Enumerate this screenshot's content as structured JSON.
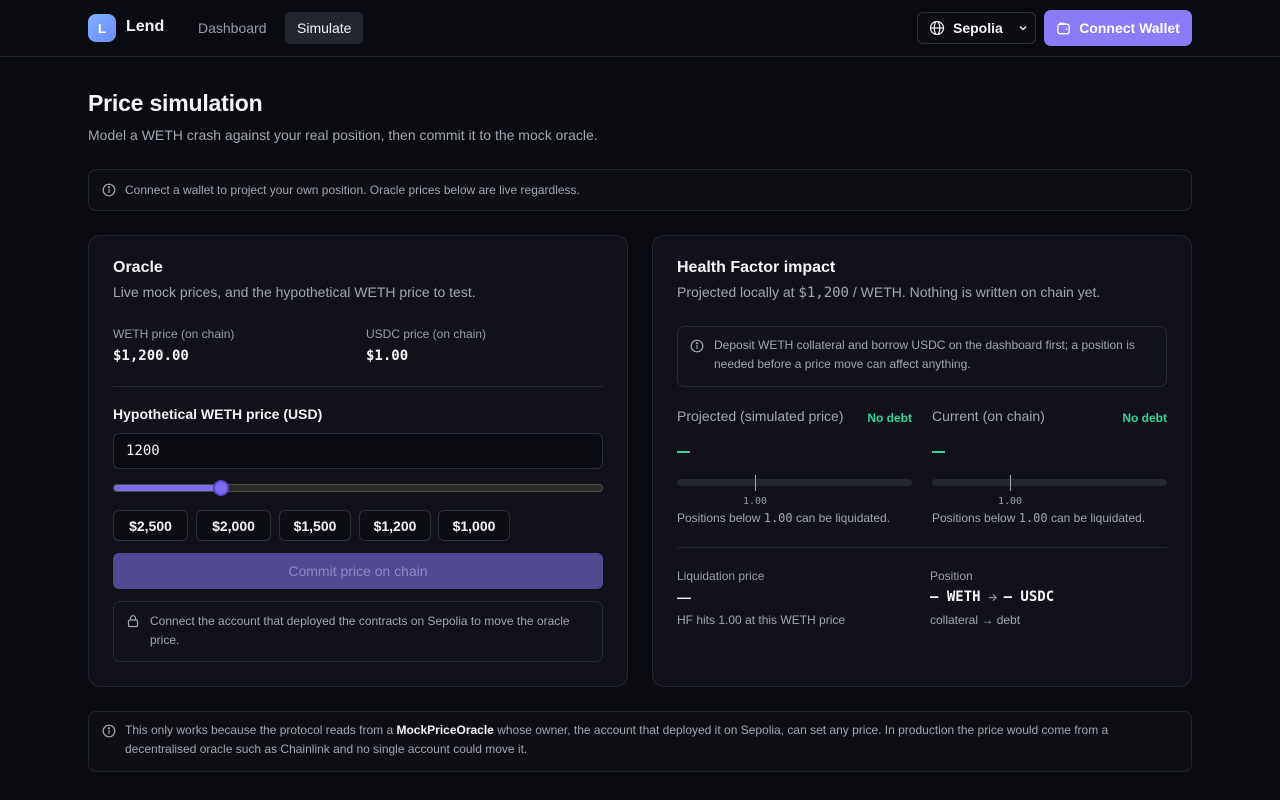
{
  "nav": {
    "logo_letter": "L",
    "brand": "Lend",
    "links": [
      "Dashboard",
      "Simulate"
    ],
    "active_link": "Simulate",
    "network": "Sepolia",
    "connect_label": "Connect Wallet"
  },
  "page": {
    "title": "Price simulation",
    "subtitle": "Model a WETH crash against your real position, then commit it to the mock oracle."
  },
  "banner": {
    "text": "Connect a wallet to project your own position. Oracle prices below are live regardless."
  },
  "oracle": {
    "title": "Oracle",
    "subtitle": "Live mock prices, and the hypothetical WETH price to test.",
    "weth_label": "WETH price (on chain)",
    "weth_value": "$1,200.00",
    "usdc_label": "USDC price (on chain)",
    "usdc_value": "$1.00",
    "input_label": "Hypothetical WETH price (USD)",
    "input_value": "1200",
    "slider_fraction": 0.22,
    "presets": [
      "$2,500",
      "$2,000",
      "$1,500",
      "$1,200",
      "$1,000"
    ],
    "commit_label": "Commit price on chain",
    "lock_note": "Connect the account that deployed the contracts on Sepolia to move the oracle price."
  },
  "health": {
    "title": "Health Factor impact",
    "subtitle_prefix": "Projected locally at",
    "subtitle_price": "$1,200",
    "subtitle_suffix": "/ WETH. Nothing is written on chain yet.",
    "info": "Deposit WETH collateral and borrow USDC on the dashboard first; a position is needed before a price move can affect anything.",
    "projected": {
      "label": "Projected (simulated price)",
      "badge": "No debt",
      "value": "—",
      "tick_label": "1.00",
      "note_prefix": "Positions below",
      "note_value": "1.00",
      "note_suffix": "can be liquidated."
    },
    "current": {
      "label": "Current (on chain)",
      "badge": "No debt",
      "value": "—",
      "tick_label": "1.00",
      "note_prefix": "Positions below",
      "note_value": "1.00",
      "note_suffix": "can be liquidated."
    },
    "liq_label": "Liquidation price",
    "liq_value": "—",
    "liq_sub": "HF hits 1.00 at this WETH price",
    "position_label": "Position",
    "position_collateral": "— WETH",
    "position_debt": "— USDC",
    "position_sub": "collateral → debt"
  },
  "footer_note": {
    "prefix": "This only works because the protocol reads from a",
    "bold": "MockPriceOracle",
    "suffix": "whose owner, the account that deployed it on Sepolia, can set any price. In production the price would come from a decentralised oracle such as Chainlink and no single account could move it."
  },
  "colors": {
    "accent": "#8c7bf7",
    "success": "#34d399",
    "background": "#0a0b10",
    "card": "#111219"
  }
}
